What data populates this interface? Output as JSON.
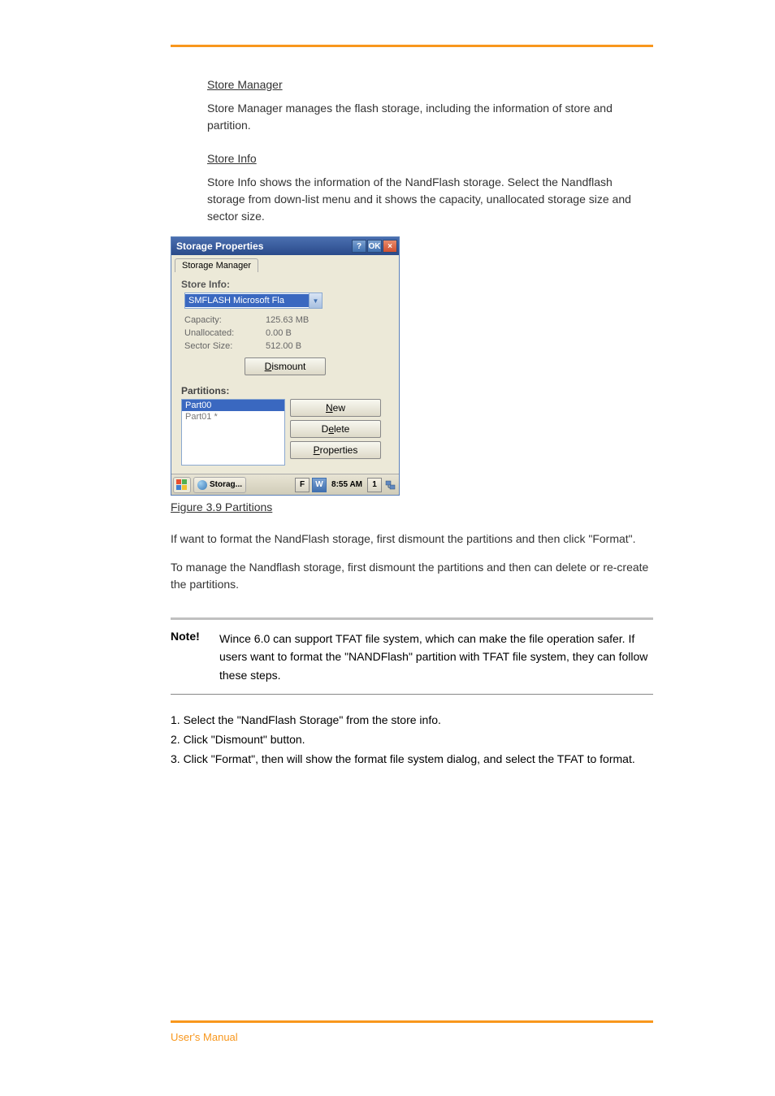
{
  "header": {
    "section_store_manager": "Store Manager",
    "para1": "Store Manager manages the flash storage, including the information of store and partition.",
    "section_store_info": "Store Info",
    "para2": "Store Info shows the information of the NandFlash storage. Select the Nandflash storage from down-list menu and it shows the capacity, unallocated storage size and sector size."
  },
  "figure_caption": "Figure 3.9 Partitions",
  "screenshot": {
    "title": "Storage Properties",
    "help_btn": "?",
    "ok_btn": "OK",
    "close_btn": "×",
    "tab": "Storage Manager",
    "store_info_label": "Store Info:",
    "dropdown_selected": "SMFLASH Microsoft Fla",
    "capacity_label": "Capacity:",
    "capacity_val": "125.63 MB",
    "unalloc_label": "Unallocated:",
    "unalloc_val": "0.00 B",
    "sector_label": "Sector Size:",
    "sector_val": "512.00 B",
    "dismount": "Dismount",
    "partitions_label": "Partitions:",
    "part_items": [
      "Part00",
      "Part01 *"
    ],
    "btn_new": "New",
    "btn_delete": "Delete",
    "btn_properties": "Properties",
    "task_label": "Storag...",
    "tray_f": "F",
    "tray_w": "W",
    "clock": "8:55 AM",
    "tray_1": "1"
  },
  "after": {
    "para3": "If want to format the NandFlash storage, first dismount the partitions and then click \"Format\".",
    "para4": "To manage the Nandflash storage, first dismount the partitions and then can delete or re-create the partitions."
  },
  "note": {
    "label": "Note!",
    "body1": "Wince 6.0 can support TFAT file system, which can make the file operation safer. If users want to format the \"NANDFlash\" partition with TFAT file system, they can follow these steps.",
    "body2a": "1. Select the \"NandFlash Storage\" from the store info.",
    "body2b": "2. Click \"Dismount\" button.",
    "body2c": "3. Click \"Format\", then will show the format file system dialog, and select the TFAT to format."
  },
  "footer": "User's Manual"
}
